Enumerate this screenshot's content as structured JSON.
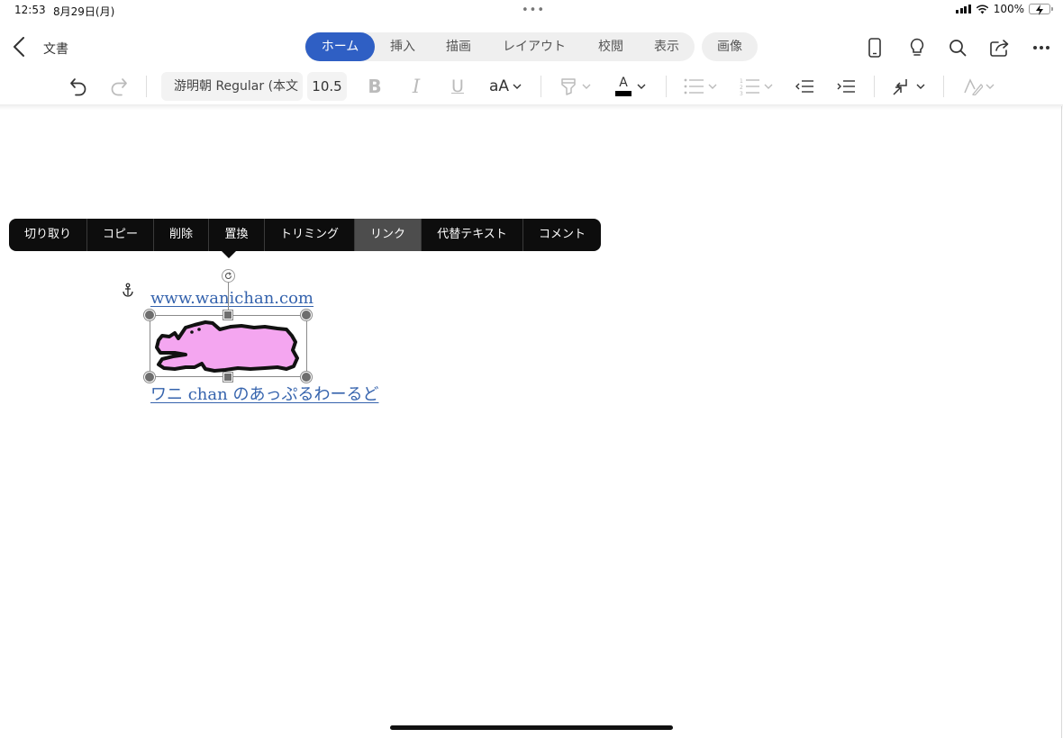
{
  "status_bar": {
    "time": "12:53",
    "date": "8月29日(月)",
    "multitask": "•••",
    "battery_percent": "100%",
    "battery_level": 1.0,
    "battery_color": "#4cd964"
  },
  "nav": {
    "back_icon": "chevron-left-icon",
    "doc_title": "文書",
    "tabs": [
      {
        "label": "ホーム",
        "active": true
      },
      {
        "label": "挿入",
        "active": false
      },
      {
        "label": "描画",
        "active": false
      },
      {
        "label": "レイアウト",
        "active": false
      },
      {
        "label": "校閲",
        "active": false
      },
      {
        "label": "表示",
        "active": false
      }
    ],
    "context_tab": "画像",
    "accent_color": "#2f5fc4",
    "right_icons": [
      "phone-layout-icon",
      "lightbulb-icon",
      "search-icon",
      "share-icon",
      "more-icon"
    ]
  },
  "ribbon": {
    "font_name": "游明朝 Regular (本文",
    "font_size": "10.5",
    "bold_label": "B",
    "italic_label": "I",
    "underline_label": "U",
    "font_size_menu_label": "aA",
    "font_color_label": "A",
    "icons": [
      "undo-icon",
      "redo-icon",
      "highlighter-icon",
      "font-color-icon",
      "bullets-icon",
      "numbering-icon",
      "decrease-indent-icon",
      "increase-indent-icon",
      "paragraph-mark-icon",
      "styles-icon"
    ]
  },
  "context_menu": {
    "items": [
      "切り取り",
      "コピー",
      "削除",
      "置換",
      "トリミング",
      "リンク",
      "代替テキスト",
      "コメント"
    ],
    "highlighted": "リンク"
  },
  "document": {
    "link_url": "www.wanichan.com",
    "link_app": "ワニ chan のあっぷるわーるど",
    "link_color": "#3563ad",
    "image_fill_color": "#f4a6f0",
    "anchor_icon": "anchor-icon"
  }
}
